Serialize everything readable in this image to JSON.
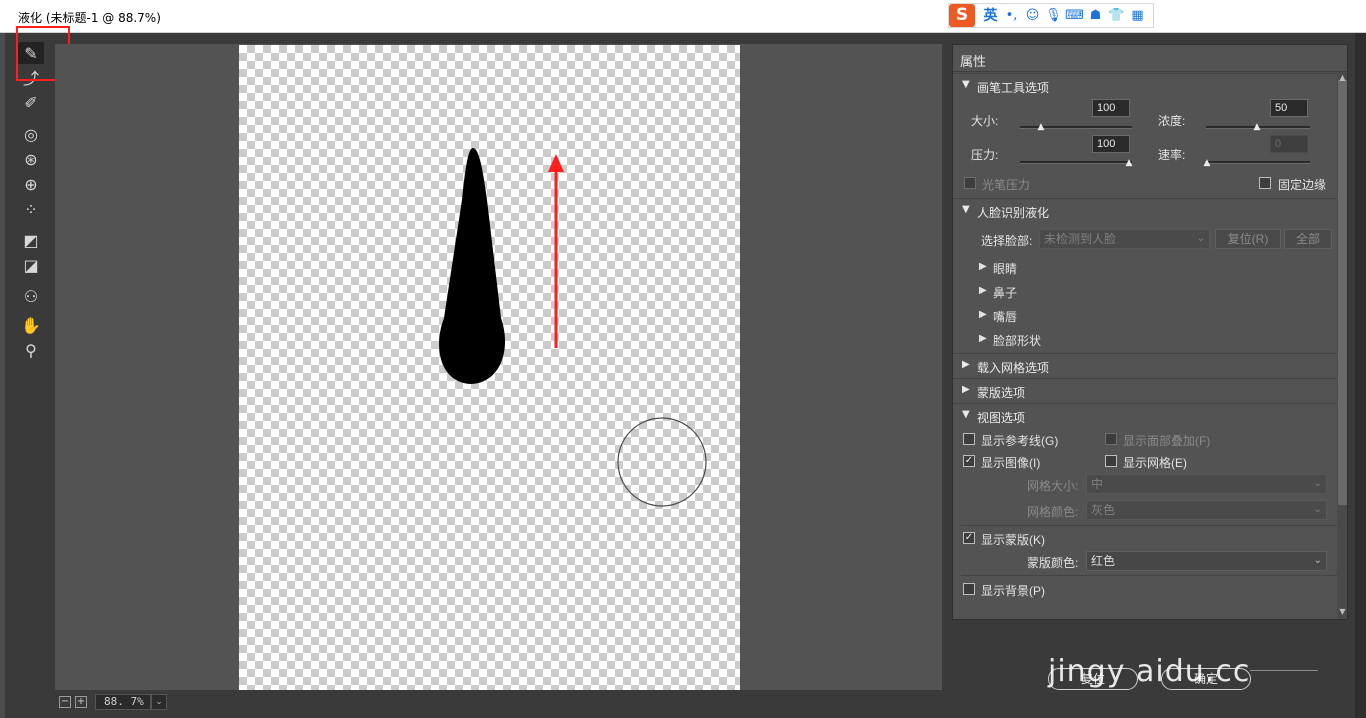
{
  "window": {
    "title": "液化 (未标题-1 @ 88.7%)"
  },
  "ime_bar": {
    "logo": "S",
    "lang": "英",
    "icons": [
      "punctuation-icon",
      "emoji-icon",
      "microphone-icon",
      "keyboard-icon",
      "user-icon",
      "skin-icon",
      "grid-icon"
    ],
    "glyphs": [
      "•,",
      "☺",
      "🎙",
      "⌨",
      "☗",
      "👕",
      "▦"
    ]
  },
  "tools": [
    {
      "name": "forward-warp-tool",
      "glyph": "✎"
    },
    {
      "name": "reconstruct-tool",
      "glyph": "⤴"
    },
    {
      "name": "smooth-tool",
      "glyph": "✐"
    },
    {
      "name": "twirl-tool",
      "glyph": "◎"
    },
    {
      "name": "pucker-tool",
      "glyph": "⊛"
    },
    {
      "name": "bloat-tool",
      "glyph": "⊕"
    },
    {
      "name": "push-left-tool",
      "glyph": "⁘"
    },
    {
      "name": "freeze-mask-tool",
      "glyph": "◩"
    },
    {
      "name": "thaw-mask-tool",
      "glyph": "◪"
    },
    {
      "name": "face-tool",
      "glyph": "⚇"
    },
    {
      "name": "hand-tool",
      "glyph": "✋"
    },
    {
      "name": "zoom-tool",
      "glyph": "⚲"
    }
  ],
  "zoom": {
    "value": "88. 7%",
    "minus": "−",
    "plus": "+",
    "dropdown": "⌄"
  },
  "panel": {
    "title": "属性",
    "brush": {
      "header": "画笔工具选项",
      "size_label": "大小:",
      "size_value": "100",
      "density_label": "浓度:",
      "density_value": "50",
      "pressure_label": "压力:",
      "pressure_value": "100",
      "rate_label": "速率:",
      "rate_value": "0",
      "stylus_pressure": "光笔压力",
      "pin_edges": "固定边缘"
    },
    "face": {
      "header": "人脸识别液化",
      "select_face_label": "选择脸部:",
      "select_face_value": "未检测到人脸",
      "reset_button": "复位(R)",
      "all_button": "全部",
      "subs": [
        "眼睛",
        "鼻子",
        "嘴唇",
        "脸部形状"
      ]
    },
    "load_mesh": "载入网格选项",
    "mask_options": "蒙版选项",
    "view": {
      "header": "视图选项",
      "show_guides": "显示参考线(G)",
      "show_face_overlay": "显示面部叠加(F)",
      "show_image": "显示图像(I)",
      "show_mesh": "显示网格(E)",
      "mesh_size_label": "网格大小:",
      "mesh_size_value": "中",
      "mesh_color_label": "网格颜色:",
      "mesh_color_value": "灰色",
      "show_mask": "显示蒙版(K)",
      "mask_color_label": "蒙版颜色:",
      "mask_color_value": "红色",
      "show_backdrop": "显示背景(P)"
    },
    "states": {
      "show_image_checked": true,
      "show_mask_checked": true
    }
  },
  "footer": {
    "reset_button": "复位",
    "ok_button": "确定"
  },
  "watermark": {
    "text": "jingy   aidu.cc"
  },
  "colors": {
    "annotation_red": "#ff1f1f",
    "panel_bg": "#535353",
    "canvas_bg": "#535353"
  }
}
